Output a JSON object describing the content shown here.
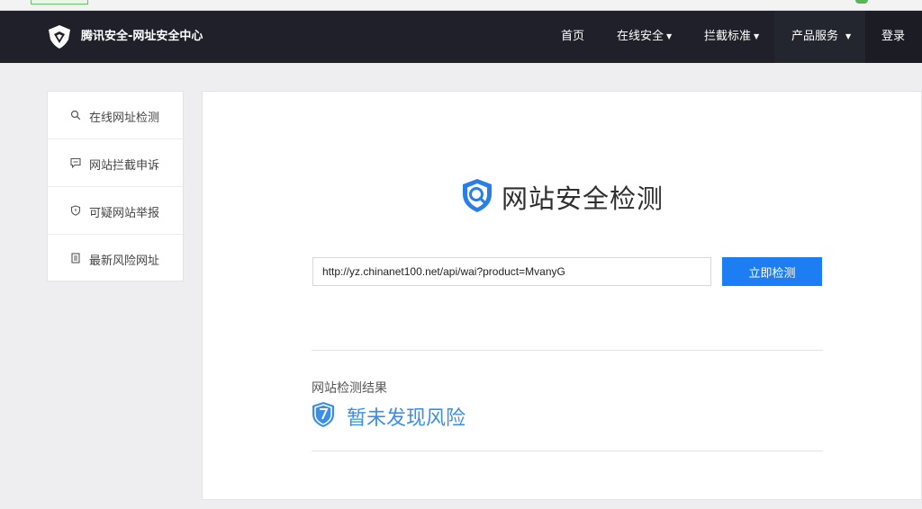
{
  "header": {
    "site_title": "腾讯安全-网址安全中心",
    "nav": [
      {
        "label": "首页",
        "has_caret": false
      },
      {
        "label": "在线安全",
        "has_caret": true
      },
      {
        "label": "拦截标准",
        "has_caret": true
      },
      {
        "label": "产品服务",
        "has_caret": true
      },
      {
        "label": "登录",
        "has_caret": false
      }
    ],
    "caret_glyph": "▼"
  },
  "sidebar": {
    "items": [
      {
        "label": "在线网址检测",
        "icon": "search-icon"
      },
      {
        "label": "网站拦截申诉",
        "icon": "chat-bubble-icon"
      },
      {
        "label": "可疑网站举报",
        "icon": "shield-icon"
      },
      {
        "label": "最新风险网址",
        "icon": "document-list-icon"
      }
    ]
  },
  "main": {
    "title": "网站安全检测",
    "url_value": "http://yz.chinanet100.net/api/wai?product=MvanyG",
    "check_button": "立即检测",
    "result_heading": "网站检测结果",
    "result_text": "暂未发现风险"
  },
  "colors": {
    "header_bg": "#1f2029",
    "accent": "#1d7df2",
    "result_blue": "#3a8ee6",
    "page_bg": "#eeeef0"
  }
}
